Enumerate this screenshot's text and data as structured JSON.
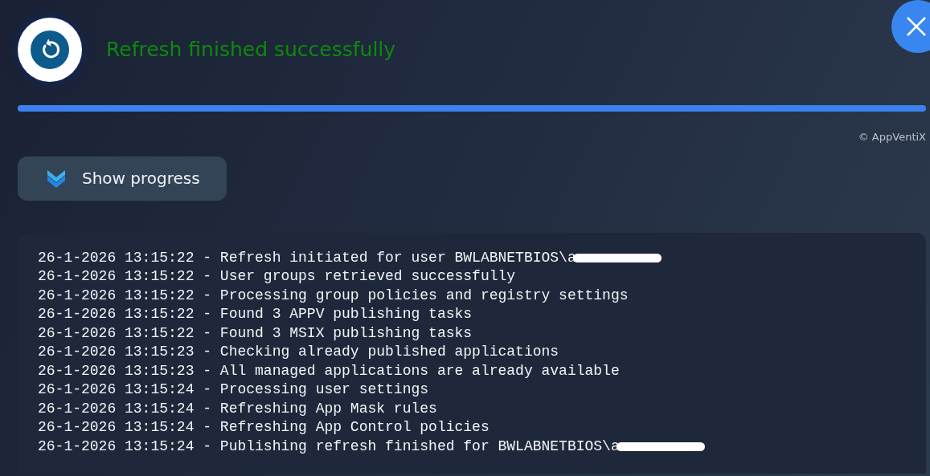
{
  "header": {
    "title": "Refresh finished successfully"
  },
  "progress": {
    "level": 1
  },
  "copyright": "© AppVentiX",
  "toggle_button": {
    "label": "Show progress",
    "expanded": false
  },
  "log": [
    {
      "text": "26-1-2026 13:15:22 - Refresh initiated for user BWLABNETBIOS\\a",
      "redacted": true
    },
    {
      "text": "26-1-2026 13:15:22 - User groups retrieved successfully",
      "redacted": false
    },
    {
      "text": "26-1-2026 13:15:22 - Processing group policies and registry settings",
      "redacted": false
    },
    {
      "text": "26-1-2026 13:15:22 - Found 3 APPV publishing tasks",
      "redacted": false
    },
    {
      "text": "26-1-2026 13:15:22 - Found 3 MSIX publishing tasks",
      "redacted": false
    },
    {
      "text": "26-1-2026 13:15:23 - Checking already published applications",
      "redacted": false
    },
    {
      "text": "26-1-2026 13:15:23 - All managed applications are already available",
      "redacted": false
    },
    {
      "text": "26-1-2026 13:15:24 - Processing user settings",
      "redacted": false
    },
    {
      "text": "26-1-2026 13:15:24 - Refreshing App Mask rules",
      "redacted": false
    },
    {
      "text": "26-1-2026 13:15:24 - Refreshing App Control policies",
      "redacted": false
    },
    {
      "text": "26-1-2026 13:15:24 - Publishing refresh finished for BWLABNETBIOS\\a",
      "redacted": true
    }
  ]
}
